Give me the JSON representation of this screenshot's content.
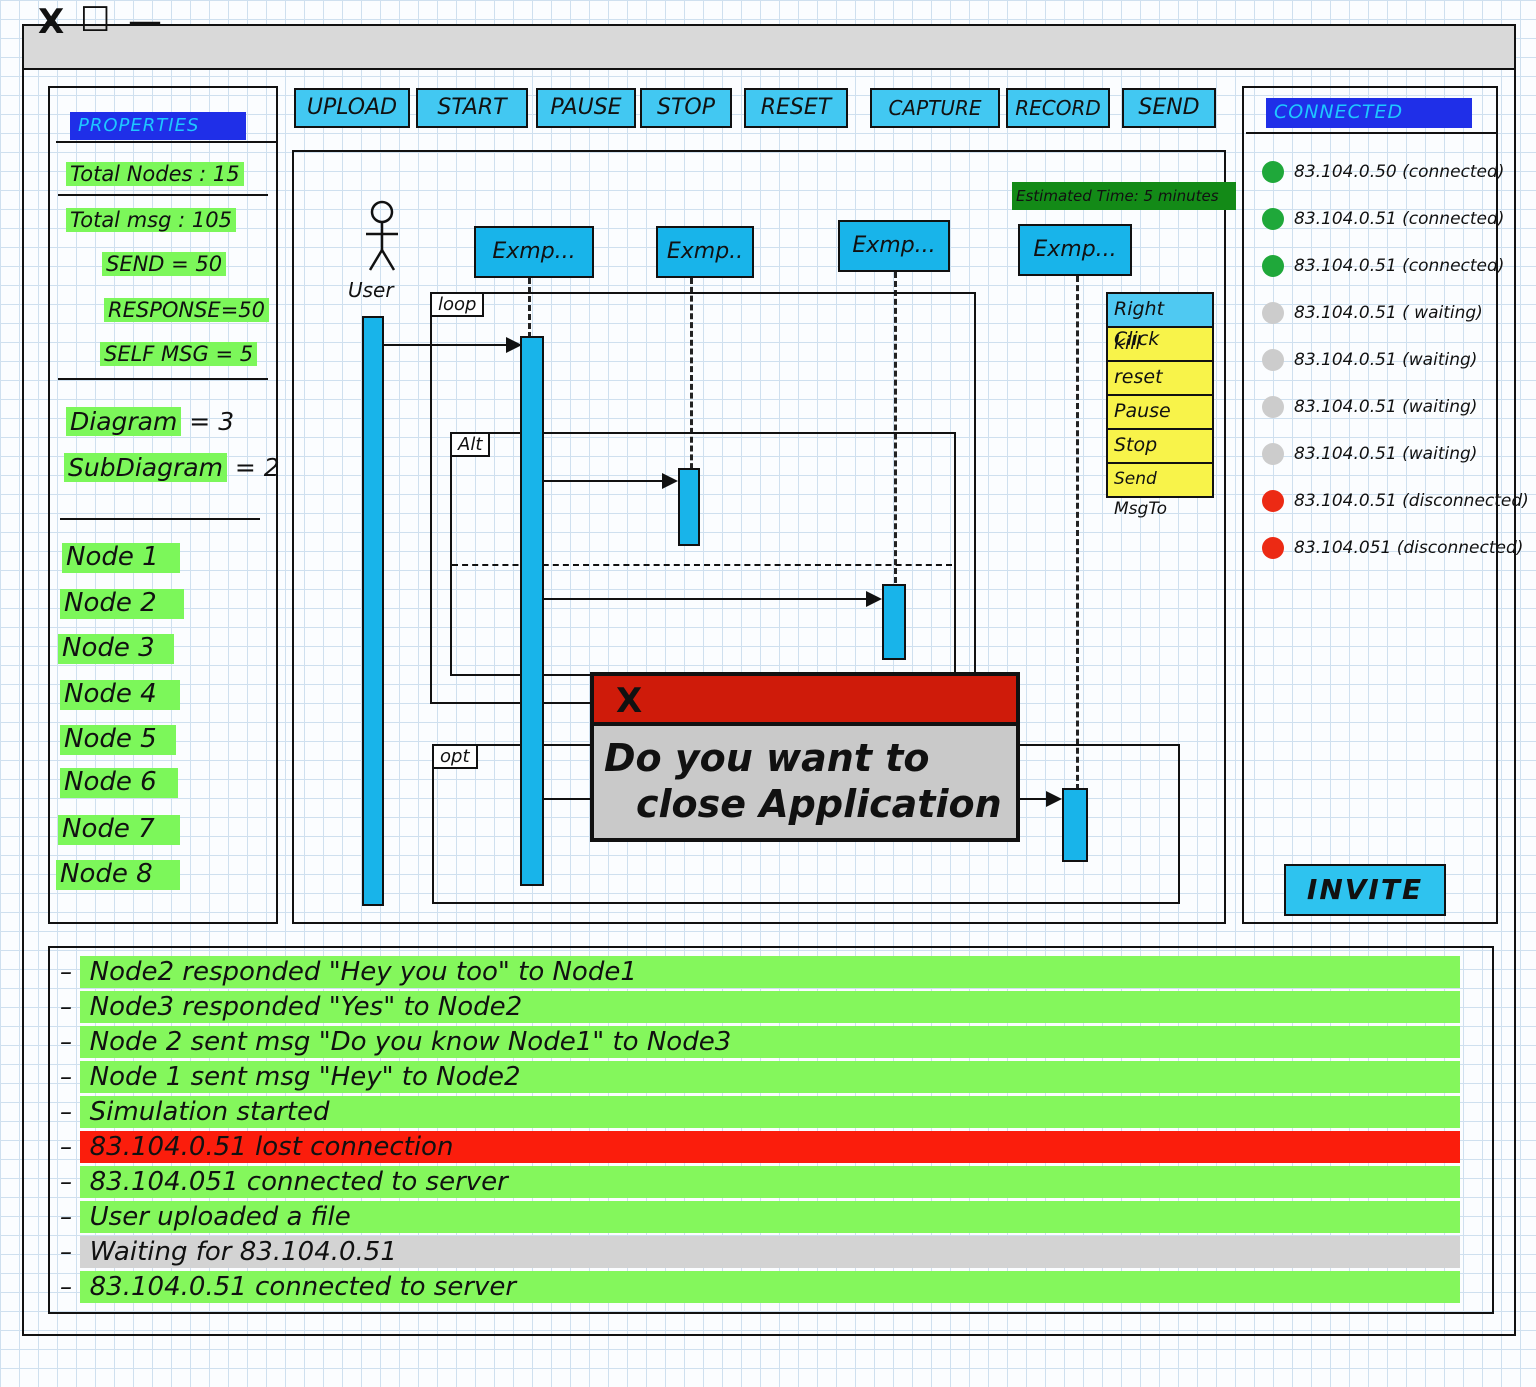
{
  "window": {
    "controls": {
      "close": "X",
      "maximize": "☐",
      "minimize": "—"
    }
  },
  "properties": {
    "title": "PROPERTIES",
    "total_nodes": "Total Nodes : 15",
    "total_msg": "Total msg : 105",
    "send": "SEND = 50",
    "response": "RESPONSE=50",
    "self_msg": "SELF MSG = 5",
    "diagram": "Diagram",
    "diagram_count": "= 3",
    "subdiagram": "SubDiagram",
    "subdiagram_count": "= 2",
    "nodes": [
      "Node 1",
      "Node 2",
      "Node 3",
      "Node 4",
      "Node 5",
      "Node 6",
      "Node 7",
      "Node 8"
    ]
  },
  "toolbar": {
    "buttons": [
      "UPLOAD",
      "START",
      "PAUSE",
      "STOP",
      "RESET",
      "CAPTURE",
      "RECORD",
      "SEND"
    ]
  },
  "diagram": {
    "estimated_time": "Estimated Time: 5 minutes",
    "actor": "User",
    "participants": [
      "Exmp...",
      "Exmp..",
      "Exmp...",
      "Exmp..."
    ],
    "frames": {
      "loop": "loop",
      "alt": "Alt",
      "opt": "opt"
    },
    "context_menu": {
      "header": "Right Click",
      "items": [
        "kill",
        "reset",
        "Pause",
        "Stop",
        "Send MsgTo"
      ]
    },
    "dialog": {
      "close": "X",
      "line1": "Do you want to",
      "line2": "close Application"
    }
  },
  "connected": {
    "title": "CONNECTED",
    "items": [
      {
        "text": "83.104.0.50 (connected)",
        "status": "connected"
      },
      {
        "text": "83.104.0.51 (connected)",
        "status": "connected"
      },
      {
        "text": "83.104.0.51 (connected)",
        "status": "connected"
      },
      {
        "text": "83.104.0.51 ( waiting)",
        "status": "waiting"
      },
      {
        "text": "83.104.0.51 (waiting)",
        "status": "waiting"
      },
      {
        "text": "83.104.0.51 (waiting)",
        "status": "waiting"
      },
      {
        "text": "83.104.0.51 (waiting)",
        "status": "waiting"
      },
      {
        "text": "83.104.0.51 (disconnected)",
        "status": "disconnected"
      },
      {
        "text": "83.104.051 (disconnected)",
        "status": "disconnected"
      }
    ],
    "invite": "INVITE",
    "colors": {
      "connected": "#1fa83a",
      "waiting": "#cccccc",
      "disconnected": "#ec2a14"
    }
  },
  "log": {
    "entries": [
      {
        "text": "Node2 responded \"Hey you too\" to Node1",
        "type": "ok"
      },
      {
        "text": "Node3 responded \"Yes\" to Node2",
        "type": "ok"
      },
      {
        "text": "Node 2 sent msg \"Do you know Node1\" to Node3",
        "type": "ok"
      },
      {
        "text": "Node 1 sent msg \"Hey\" to Node2",
        "type": "ok"
      },
      {
        "text": "Simulation started",
        "type": "ok"
      },
      {
        "text": "83.104.0.51 lost connection",
        "type": "error"
      },
      {
        "text": "83.104.051 connected to server",
        "type": "ok"
      },
      {
        "text": "User uploaded a file",
        "type": "ok"
      },
      {
        "text": "Waiting for 83.104.0.51",
        "type": "waiting"
      },
      {
        "text": "83.104.0.51 connected to server",
        "type": "ok"
      }
    ],
    "colors": {
      "ok": "#84f75c",
      "error": "#fb1d0c",
      "waiting": "#d3d3d3"
    }
  }
}
